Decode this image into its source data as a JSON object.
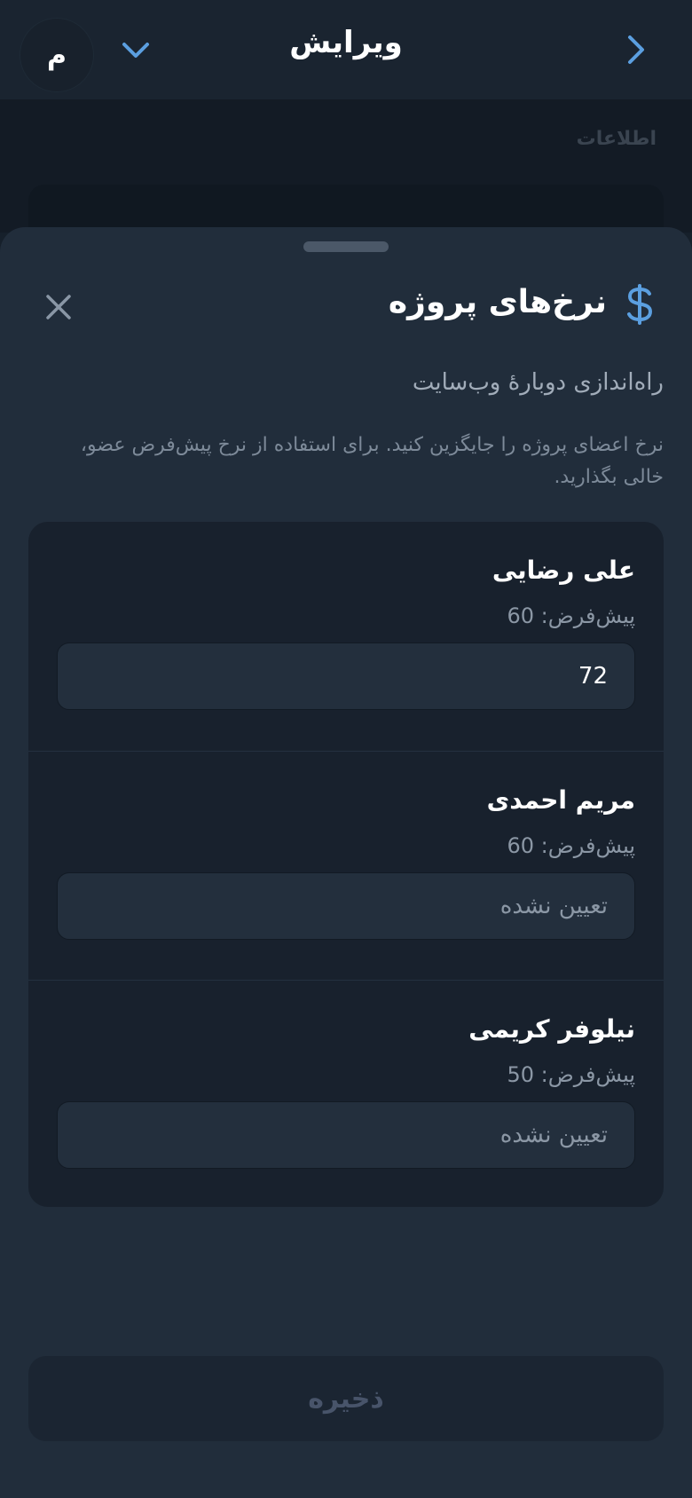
{
  "header": {
    "title": "ویرایش",
    "avatar_initial": "م"
  },
  "background": {
    "section_label": "اطلاعات"
  },
  "sheet": {
    "title": "نرخ‌های پروژه",
    "project_name": "راه‌اندازی دوبارهٔ وب‌سایت",
    "description": "نرخ اعضای پروژه را جایگزین کنید. برای استفاده از نرخ پیش‌فرض عضو، خالی بگذارید.",
    "members": [
      {
        "name": "علی رضایی",
        "default_label": "پیش‌فرض: 60",
        "rate_value": "72",
        "placeholder": "تعیین نشده"
      },
      {
        "name": "مریم احمدی",
        "default_label": "پیش‌فرض: 60",
        "rate_value": "",
        "placeholder": "تعیین نشده"
      },
      {
        "name": "نیلوفر کریمی",
        "default_label": "پیش‌فرض: 50",
        "rate_value": "",
        "placeholder": "تعیین نشده"
      }
    ],
    "save_label": "ذخیره"
  },
  "icons": {
    "back": "chevron-right-icon",
    "expand": "chevron-down-icon",
    "close": "close-icon",
    "currency": "dollar-icon"
  },
  "colors": {
    "accent": "#5b9fe0",
    "background": "#16202b",
    "sheet": "#212d3b",
    "card": "#18212d"
  }
}
